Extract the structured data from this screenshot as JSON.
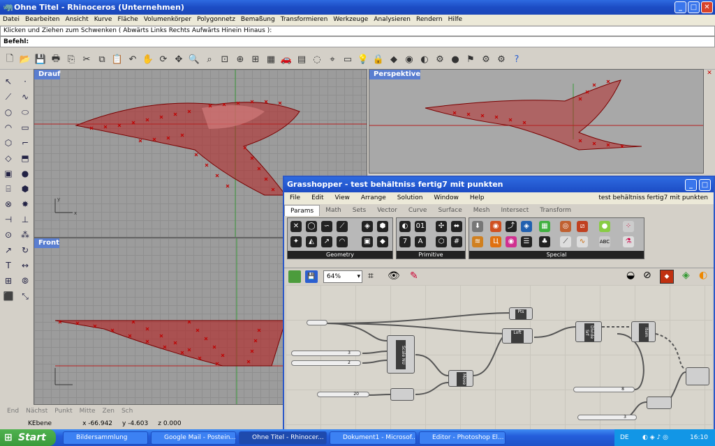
{
  "rhino": {
    "title": "Ohne Titel - Rhinoceros (Unternehmen)",
    "menu": [
      "Datei",
      "Bearbeiten",
      "Ansicht",
      "Kurve",
      "Fläche",
      "Volumenkörper",
      "Polygonnetz",
      "Bemaßung",
      "Transformieren",
      "Werkzeuge",
      "Analysieren",
      "Rendern",
      "Hilfe"
    ],
    "command_history": "Klicken und Ziehen zum Schwenken ( Abwärts  Links  Rechts  Aufwärts  Hinein  Hinaus ):",
    "command_prompt": "Befehl:",
    "viewports": {
      "top": "Drauf",
      "perspective": "Perspektive",
      "front": "Front"
    },
    "osnaps": [
      "End",
      "Nächst",
      "Punkt",
      "Mitte",
      "Zen",
      "Sch"
    ],
    "status": {
      "layer": "KEbene",
      "x": "x -66.942",
      "y": "y -4.603",
      "z": "z 0.000"
    }
  },
  "gh": {
    "title": "Grasshopper - test behältniss fertig7 mit punkten",
    "doc_name": "test behältniss fertig7 mit punkten",
    "menu": [
      "File",
      "Edit",
      "View",
      "Arrange",
      "Solution",
      "Window",
      "Help"
    ],
    "tabs": [
      "Params",
      "Math",
      "Sets",
      "Vector",
      "Curve",
      "Surface",
      "Mesh",
      "Intersect",
      "Transform"
    ],
    "panels": [
      "Geometry",
      "Primitive",
      "Special"
    ],
    "zoom": "64%",
    "sliders": [
      "3",
      "2",
      "20",
      "8",
      "3"
    ],
    "components": [
      "Point",
      "Scale NU",
      "Loft",
      "Divide Srf",
      "Item",
      "Move",
      "Pts"
    ]
  },
  "taskbar": {
    "start": "Start",
    "tasks": [
      "Bildersammlung",
      "Google Mail - Postein...",
      "Ohne Titel - Rhinocer...",
      "Dokument1 - Microsof...",
      "Editor - Photoshop El..."
    ],
    "lang": "DE",
    "clock": "16:10"
  },
  "colors": {
    "xp_blue": "#245edb",
    "surface_red": "#b42020",
    "viewport_grey": "#9c9c9c"
  }
}
